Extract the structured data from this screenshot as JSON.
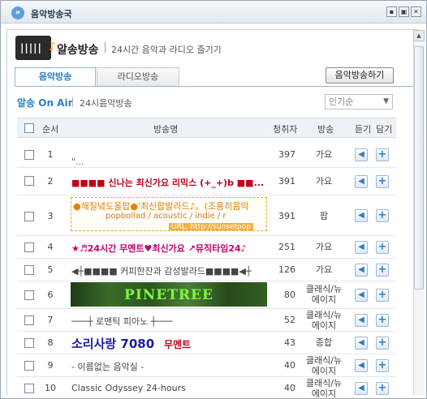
{
  "window": {
    "title": "음악방송국",
    "min_label": "▪",
    "max_label": "▣",
    "close_label": "✕"
  },
  "header": {
    "title": "알송방송",
    "subtitle": "24시간 음악과 라디오 즐기기"
  },
  "tabs": [
    {
      "label": "음악방송",
      "active": true
    },
    {
      "label": "라디오방송",
      "active": false
    }
  ],
  "action_button": "음악방송하기",
  "onair": {
    "title": "알송 On Air",
    "subtitle": "24시음악방송"
  },
  "sort": {
    "selected": "인기순"
  },
  "table": {
    "headers": {
      "num": "순서",
      "name": "방송명",
      "listeners": "청취자",
      "genre": "방송",
      "listen": "듣기",
      "add": "담기"
    },
    "rows": [
      {
        "num": "1",
        "name": "\"...",
        "listeners": "397",
        "genre": "가요"
      },
      {
        "num": "2",
        "name": "■■■■ 신나는 최신가요 리믹스 (+_+)b ■■...",
        "listeners": "391",
        "genre": "가요"
      },
      {
        "num": "3",
        "name": "",
        "banner_line1": "●해질녘도올팝●'최신팝발라드♪。(조용히음악",
        "banner_line2": "popbollad / acoustic / indie / r",
        "banner_line3": "URL. http://sunsetpop",
        "listeners": "391",
        "genre": "팝"
      },
      {
        "num": "4",
        "name": "★♬24시간 무멘트♥최신가요 ↗뮤직타임24♪",
        "listeners": "251",
        "genre": "가요"
      },
      {
        "num": "5",
        "name": "◀┼■■■■ 커피한잔과 감성발라드■■■■◀┼",
        "listeners": "126",
        "genre": "가요"
      },
      {
        "num": "6",
        "name": "PINETREE",
        "listeners": "80",
        "genre": "클래식/뉴에이지"
      },
      {
        "num": "7",
        "name": "───┼ 로맨틱 피아노 ┼───",
        "listeners": "52",
        "genre": "클래식/뉴에이지"
      },
      {
        "num": "8",
        "name": "소리사랑 7080",
        "name_extra": "무멘트",
        "listeners": "43",
        "genre": "종합"
      },
      {
        "num": "9",
        "name": "- 이름없는 음악실 -",
        "listeners": "40",
        "genre": "클래식/뉴에이지"
      },
      {
        "num": "10",
        "name": "Classic Odyssey 24-hours",
        "listeners": "40",
        "genre": "클래식/뉴에이지"
      }
    ]
  },
  "colors": {
    "accent": "#2c7fc4",
    "row2_name": "#c0001a",
    "row4_name": "#c0006a",
    "row8_name": "#1a1aa8",
    "pinetree_text": "#7cff3a"
  },
  "icons": {
    "listen": "speaker-icon",
    "add": "plus-icon",
    "title": "broadcast-icon"
  }
}
